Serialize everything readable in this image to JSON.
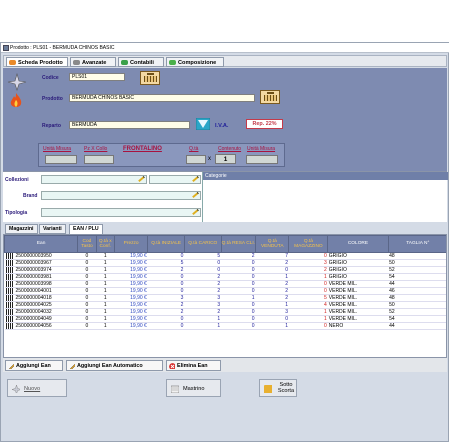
{
  "window": {
    "title": "Prodotto : PLS01 - BERMUDA CHINOS BASIC"
  },
  "tabs": [
    {
      "label": "Scheda Prodotto",
      "icon": "card-icon"
    },
    {
      "label": "Avanzate",
      "icon": "tools-icon"
    },
    {
      "label": "Contabili",
      "icon": "money-icon"
    },
    {
      "label": "Composizione",
      "icon": "puzzle-icon"
    }
  ],
  "product": {
    "codice_label": "Codice",
    "codice_value": "PLS01",
    "prodotto_label": "Prodotto",
    "prodotto_value": "BERMUDA CHINOS BASIC",
    "reparto_label": "Reparto",
    "reparto_value": "BERMUDA",
    "iva_label": "I.V.A.",
    "rep_badge": "Rep. 22%",
    "unita_misura_label": "Unità Misura",
    "pz_collo_label": "Pz X Collo",
    "frontalino_label": "FRONTALINO",
    "qta_label": "Q.tà",
    "multiply": "x",
    "contenuto_qta": "1",
    "contenuto_label": "Contenuto",
    "unita_misura2_label": "Unità Misura"
  },
  "classification": {
    "collezioni_label": "Collezioni",
    "brand_label": "Brand",
    "tipologia_label": "Tipologia",
    "categorie_label": "Categorie"
  },
  "lower_tabs": [
    "Magazzini",
    "Varianti",
    "EAN / PLU"
  ],
  "grid": {
    "headers": [
      "Ean",
      "Cod Tasto",
      "Q.tà x Conf.",
      "Prezzo",
      "Q.tà INIZIALE",
      "Q.tà CARICO",
      "Q.tà RESA CLI.",
      "Q.tà VENDUTA",
      "Q.tà MAGAZZINO",
      "COLORE",
      "TAGLIA N°"
    ],
    "rows": [
      [
        "2500000003950",
        "0",
        "1",
        "19,90 €",
        "0",
        "5",
        "2",
        "7",
        "0",
        "GRIGIO",
        "48"
      ],
      [
        "2500000003967",
        "0",
        "1",
        "19,90 €",
        "5",
        "0",
        "0",
        "2",
        "3",
        "GRIGIO",
        "50"
      ],
      [
        "2500000003974",
        "0",
        "1",
        "19,90 €",
        "2",
        "0",
        "0",
        "0",
        "2",
        "GRIGIO",
        "52"
      ],
      [
        "2500000003981",
        "0",
        "1",
        "19,90 €",
        "0",
        "2",
        "0",
        "1",
        "1",
        "GRIGIO",
        "54"
      ],
      [
        "2500000003998",
        "0",
        "1",
        "19,90 €",
        "0",
        "2",
        "0",
        "2",
        "0",
        "VERDE MIL.",
        "44"
      ],
      [
        "2500000004001",
        "0",
        "1",
        "19,90 €",
        "0",
        "2",
        "0",
        "2",
        "0",
        "VERDE MIL.",
        "46"
      ],
      [
        "2500000004018",
        "0",
        "1",
        "19,90 €",
        "3",
        "3",
        "1",
        "2",
        "5",
        "VERDE MIL.",
        "48"
      ],
      [
        "2500000004025",
        "0",
        "1",
        "19,90 €",
        "2",
        "3",
        "0",
        "1",
        "4",
        "VERDE MIL.",
        "50"
      ],
      [
        "2500000004032",
        "0",
        "1",
        "19,90 €",
        "2",
        "2",
        "0",
        "3",
        "1",
        "VERDE MIL.",
        "52"
      ],
      [
        "2500000004049",
        "0",
        "1",
        "19,90 €",
        "0",
        "1",
        "0",
        "0",
        "1",
        "VERDE MIL.",
        "54"
      ],
      [
        "2500000004056",
        "0",
        "1",
        "19,90 €",
        "0",
        "1",
        "0",
        "1",
        "0",
        "NERO",
        "44"
      ]
    ]
  },
  "actions": {
    "add_ean": "Aggiungi Ean",
    "add_ean_auto": "Aggiungi Ean Automatico",
    "delete_ean": "Elimina Ean"
  },
  "footer": {
    "nuovo": "Nuovo",
    "mastrino": "Mastrino",
    "sotto_scorta": "Sotto Scorta"
  },
  "colors": {
    "header_bg": "#7e8bb1",
    "grid_header_text": "#f5c24a",
    "accent_red": "#d02020",
    "accent_blue": "#2b45c0"
  }
}
